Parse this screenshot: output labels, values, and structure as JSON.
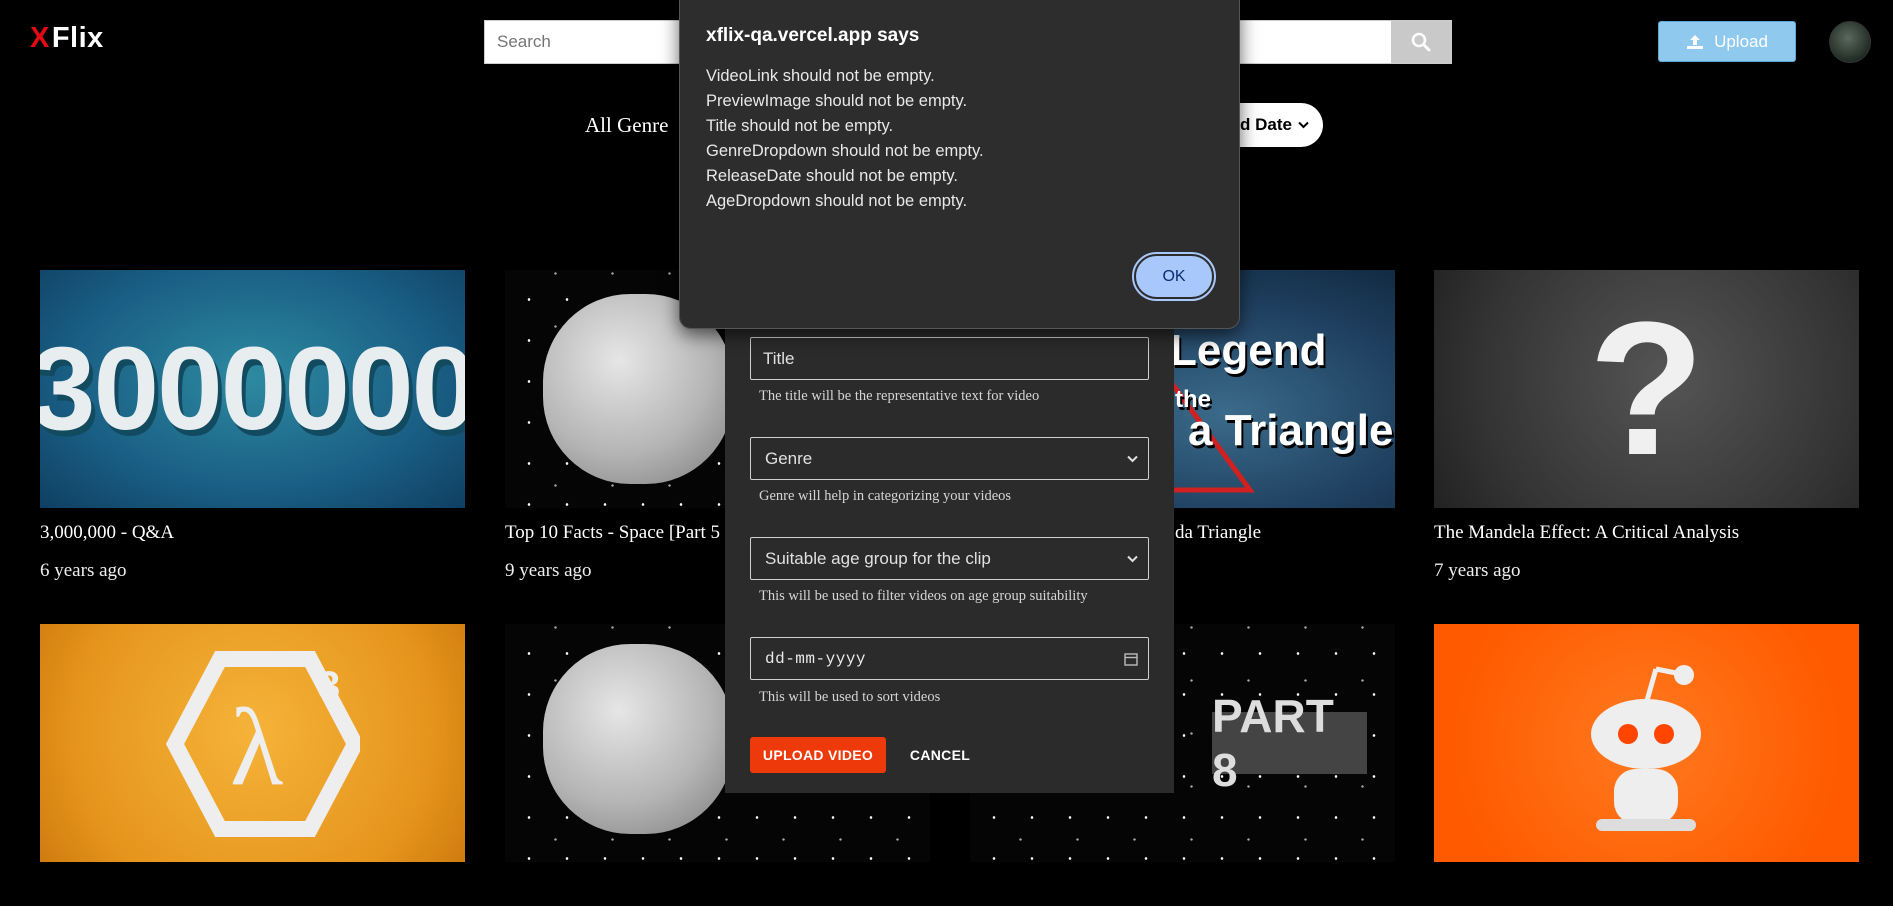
{
  "header": {
    "logo_x": "X",
    "logo_text": "Flix",
    "search_placeholder": "Search",
    "upload_label": "Upload"
  },
  "filters": {
    "genre_label": "All Genre",
    "sort_label": "d Date"
  },
  "videos": [
    {
      "title": "3,000,000 - Q&A",
      "age": "6 years ago",
      "thumb_text": "3000000"
    },
    {
      "title": "Top 10 Facts - Space [Part 5",
      "age": "9 years ago"
    },
    {
      "title": "da Triangle",
      "age": "",
      "thumb_text_1": "Legend",
      "thumb_text_2": "the",
      "thumb_text_3": "a Triangle"
    },
    {
      "title": "The Mandela Effect: A Critical Analysis",
      "age": "7 years ago",
      "thumb_text": "?"
    },
    {
      "title": "",
      "age": ""
    },
    {
      "title": "",
      "age": ""
    },
    {
      "title": "",
      "age": "",
      "thumb_text": "PART 8"
    },
    {
      "title": "",
      "age": ""
    }
  ],
  "upload_modal": {
    "title_placeholder": "Title",
    "title_help": "The title will be the representative text for video",
    "genre_placeholder": "Genre",
    "genre_help": "Genre will help in categorizing your videos",
    "age_placeholder": "Suitable age group for the clip",
    "age_help": "This will be used to filter videos on age group suitability",
    "date_placeholder": "dd-mm-yyyy",
    "date_help": "This will be used to sort videos",
    "upload_button": "UPLOAD VIDEO",
    "cancel_button": "CANCEL"
  },
  "alert": {
    "title": "xflix-qa.vercel.app says",
    "messages": [
      "VideoLink should not be empty.",
      "PreviewImage should not be empty.",
      "Title should not be empty.",
      "GenreDropdown should not be empty.",
      "ReleaseDate should not be empty.",
      "AgeDropdown should not be empty."
    ],
    "ok_label": "OK"
  },
  "colors": {
    "background": "#000000",
    "logo_accent": "#e50914",
    "upload_button": "#8fc9ee",
    "modal_bg": "#2b2b2b",
    "upload_video_button": "#ee3a0a",
    "alert_bg": "#2d2d2d",
    "alert_ok": "#a8c7fa"
  },
  "icons": [
    "search-icon",
    "upload-icon",
    "chevron-down-icon",
    "calendar-icon"
  ]
}
